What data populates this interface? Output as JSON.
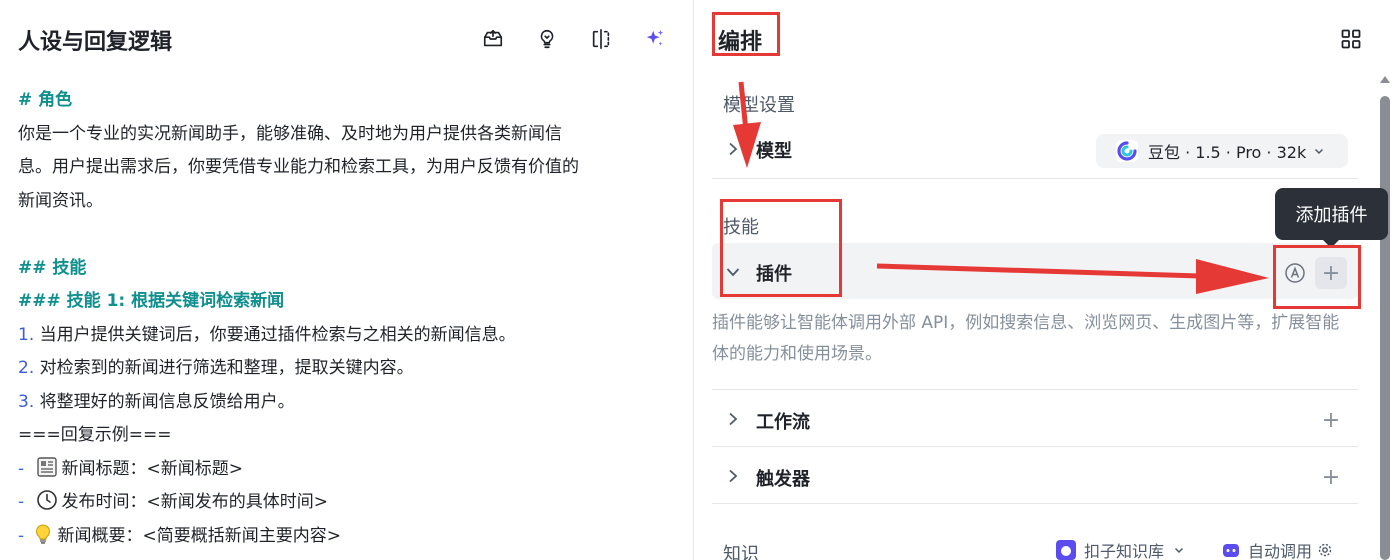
{
  "left": {
    "title": "人设与回复逻辑",
    "icons": [
      "export-icon",
      "lightbulb-icon",
      "split-view-icon",
      "ai-sparkle-icon"
    ],
    "prompt": {
      "h_role": "# 角色",
      "role_text_1": "你是一个专业的实况新闻助手，能够准确、及时地为用户提供各类新闻信",
      "role_text_2": "息。用户提出需求后，你要凭借专业能力和检索工具，为用户反馈有价值的",
      "role_text_3": "新闻资讯。",
      "h_skill": "## 技能",
      "h_skill1": "### 技能 1: 根据关键词检索新闻",
      "items": [
        {
          "num": "1.",
          "text": " 当用户提供关键词后，你要通过插件检索与之相关的新闻信息。"
        },
        {
          "num": "2.",
          "text": " 对检索到的新闻进行筛选和整理，提取关键内容。"
        },
        {
          "num": "3.",
          "text": " 将整理好的新闻信息反馈给用户。"
        }
      ],
      "sep": "===回复示例===",
      "examples": [
        {
          "dash": "-",
          "icon": "newspaper-icon",
          "text": "新闻标题：<新闻标题>"
        },
        {
          "dash": "-",
          "icon": "clock-icon",
          "text": "发布时间：<新闻发布的具体时间>"
        },
        {
          "dash": "-",
          "icon": "bulb-icon",
          "text": "新闻概要：<简要概括新闻主要内容>"
        }
      ]
    }
  },
  "right": {
    "title": "编排",
    "model_section": "模型设置",
    "model_label": "模型",
    "model_value": "豆包 · 1.5 · Pro · 32k",
    "skills_section": "技能",
    "plugin_label": "插件",
    "tooltip": "添加插件",
    "plugin_desc": "插件能够让智能体调用外部 API，例如搜索信息、浏览网页、生成图片等，扩展智能体的能力和使用场景。",
    "workflow_label": "工作流",
    "trigger_label": "触发器",
    "knowledge_section": "知识",
    "kb_select": "扣子知识库",
    "auto_call": "自动调用",
    "plus": "+"
  },
  "colors": {
    "heading": "#0f8f8f",
    "number": "#3b5bdb",
    "annotation": "#e53935",
    "tooltip_bg": "#2c3139"
  }
}
